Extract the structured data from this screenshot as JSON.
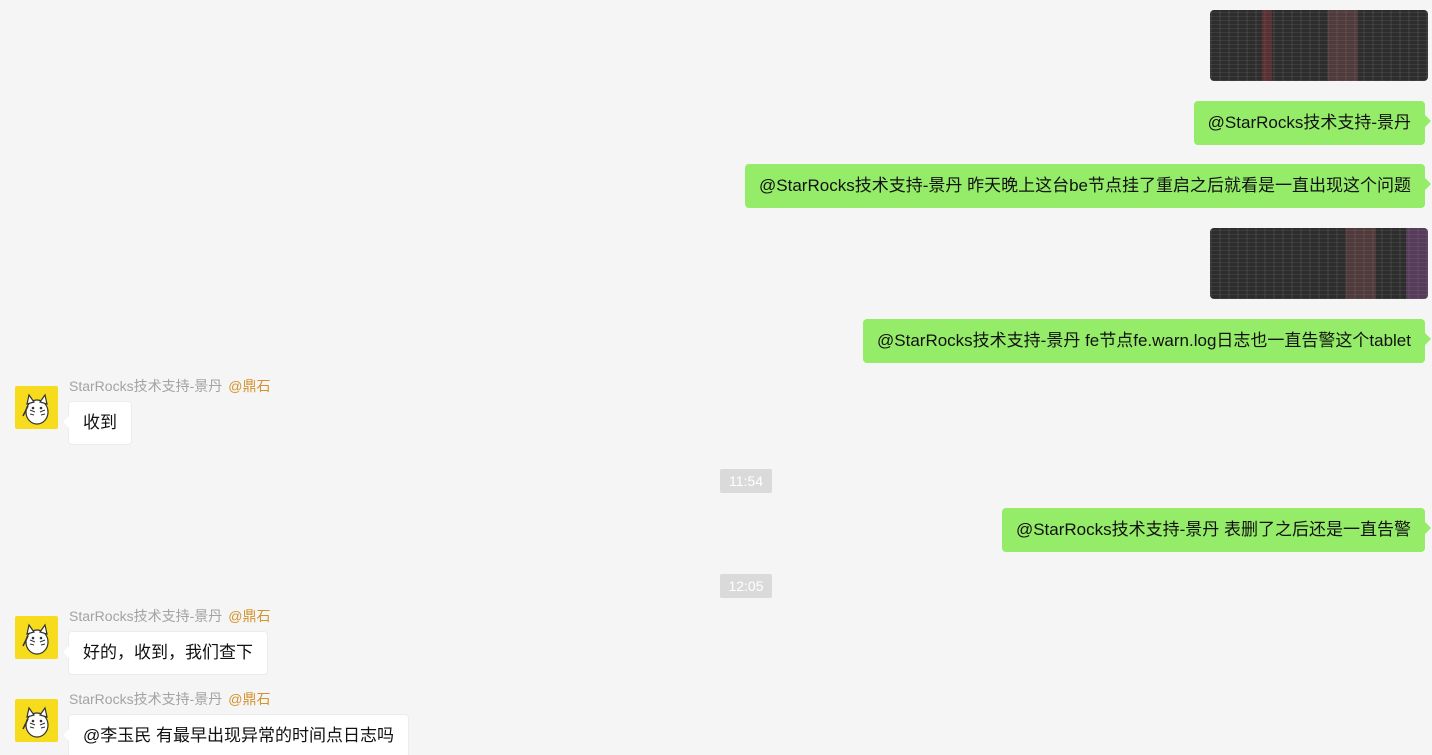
{
  "messages": {
    "out_1_text": "@StarRocks技术支持-景丹",
    "out_2_text": "@StarRocks技术支持-景丹 昨天晚上这台be节点挂了重启之后就看是一直出现这个问题",
    "out_3_text": "@StarRocks技术支持-景丹 fe节点fe.warn.log日志也一直告警这个tablet",
    "out_4_text": "@StarRocks技术支持-景丹 表删了之后还是一直告警",
    "in_1": {
      "sender": "StarRocks技术支持-景丹",
      "mention": "@鼎石",
      "text": "收到"
    },
    "in_2": {
      "sender": "StarRocks技术支持-景丹",
      "mention": "@鼎石",
      "text": "好的，收到，我们查下"
    },
    "in_3": {
      "sender": "StarRocks技术支持-景丹",
      "mention": "@鼎石",
      "text": "@李玉民 有最早出现异常的时间点日志吗"
    }
  },
  "timestamps": {
    "t1": "11:54",
    "t2": "12:05"
  },
  "colors": {
    "background": "#f5f5f5",
    "outgoing_bubble": "#95ec69",
    "incoming_bubble": "#ffffff",
    "sender_name": "#a3a3a3",
    "mention": "#d4932f",
    "avatar": "#f6dc1c",
    "timestamp_bg": "#dadada"
  },
  "icons": {
    "avatar": "cat-avatar-icon"
  }
}
